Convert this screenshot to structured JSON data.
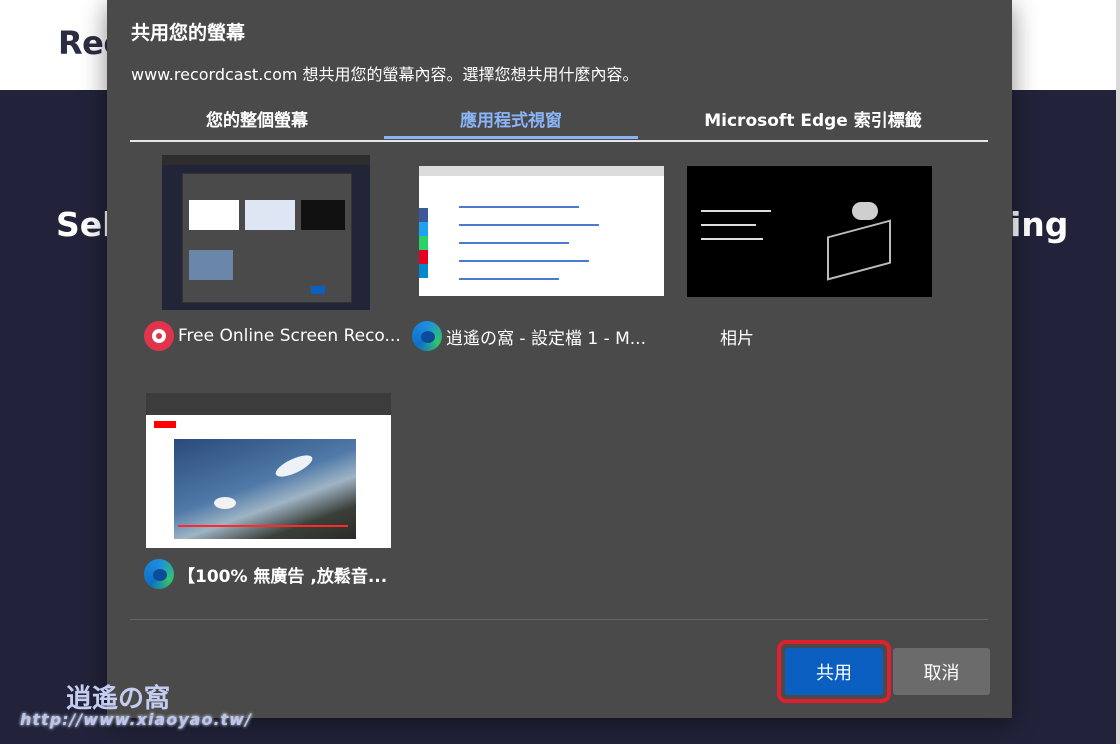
{
  "background": {
    "logo_text": "Rec",
    "heading_left": "Sel",
    "heading_right": "ing"
  },
  "dialog": {
    "title": "共用您的螢幕",
    "subtitle": "www.recordcast.com 想共用您的螢幕內容。選擇您想共用什麼內容。",
    "tabs": [
      {
        "label": "您的整個螢幕"
      },
      {
        "label": "應用程式視窗"
      },
      {
        "label": "Microsoft Edge 索引標籤"
      }
    ],
    "items": [
      {
        "label": "Free Online Screen Reco...",
        "icon": "recordcast-icon"
      },
      {
        "label": "逍遙の窩 - 設定檔 1 - M...",
        "icon": "edge-icon"
      },
      {
        "label": "相片",
        "icon": "none"
      },
      {
        "label": "【100% 無廣告 ,放鬆音...",
        "icon": "edge-icon"
      }
    ],
    "share_label": "共用",
    "cancel_label": "取消"
  },
  "watermark": {
    "brand_text": "逍遙の窩",
    "url": "http://www.xiaoyao.tw/"
  },
  "colors": {
    "dialog_bg": "#4a4a4a",
    "active_tab": "#8ab4f8",
    "share_button": "#0b5fc0",
    "highlight": "#e0202e"
  }
}
